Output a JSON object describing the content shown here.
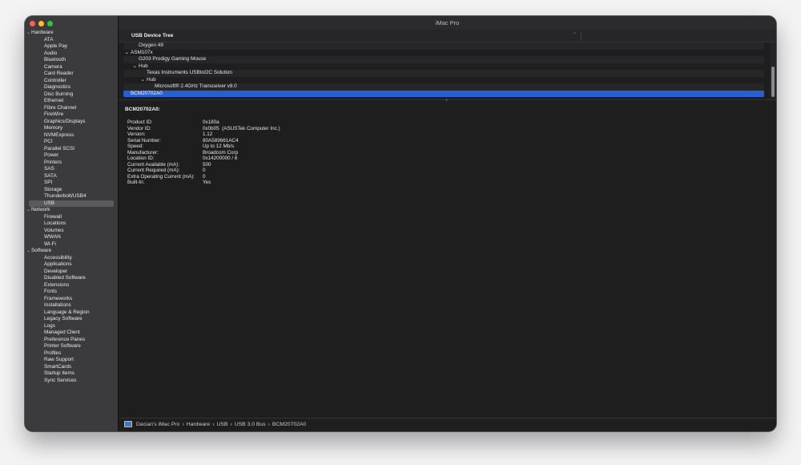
{
  "window": {
    "title": "iMac Pro"
  },
  "colors": {
    "close": "#ff5f57",
    "minimize": "#febc2e",
    "zoom": "#28c840",
    "selection": "#2660d4"
  },
  "sidebar": {
    "items": [
      {
        "label": "Hardware",
        "type": "cat"
      },
      {
        "label": "ATA",
        "type": "item"
      },
      {
        "label": "Apple Pay",
        "type": "item"
      },
      {
        "label": "Audio",
        "type": "item"
      },
      {
        "label": "Bluetooth",
        "type": "item"
      },
      {
        "label": "Camera",
        "type": "item"
      },
      {
        "label": "Card Reader",
        "type": "item"
      },
      {
        "label": "Controller",
        "type": "item"
      },
      {
        "label": "Diagnostics",
        "type": "item"
      },
      {
        "label": "Disc Burning",
        "type": "item"
      },
      {
        "label": "Ethernet",
        "type": "item"
      },
      {
        "label": "Fibre Channel",
        "type": "item"
      },
      {
        "label": "FireWire",
        "type": "item"
      },
      {
        "label": "Graphics/Displays",
        "type": "item"
      },
      {
        "label": "Memory",
        "type": "item"
      },
      {
        "label": "NVMExpress",
        "type": "item"
      },
      {
        "label": "PCI",
        "type": "item"
      },
      {
        "label": "Parallel SCSI",
        "type": "item"
      },
      {
        "label": "Power",
        "type": "item"
      },
      {
        "label": "Printers",
        "type": "item"
      },
      {
        "label": "SAS",
        "type": "item"
      },
      {
        "label": "SATA",
        "type": "item"
      },
      {
        "label": "SPI",
        "type": "item"
      },
      {
        "label": "Storage",
        "type": "item"
      },
      {
        "label": "Thunderbolt/USB4",
        "type": "item"
      },
      {
        "label": "USB",
        "type": "item",
        "selected": true
      },
      {
        "label": "Network",
        "type": "cat"
      },
      {
        "label": "Firewall",
        "type": "item"
      },
      {
        "label": "Locations",
        "type": "item"
      },
      {
        "label": "Volumes",
        "type": "item"
      },
      {
        "label": "WWAN",
        "type": "item"
      },
      {
        "label": "Wi-Fi",
        "type": "item"
      },
      {
        "label": "Software",
        "type": "cat"
      },
      {
        "label": "Accessibility",
        "type": "item"
      },
      {
        "label": "Applications",
        "type": "item"
      },
      {
        "label": "Developer",
        "type": "item"
      },
      {
        "label": "Disabled Software",
        "type": "item"
      },
      {
        "label": "Extensions",
        "type": "item"
      },
      {
        "label": "Fonts",
        "type": "item"
      },
      {
        "label": "Frameworks",
        "type": "item"
      },
      {
        "label": "Installations",
        "type": "item"
      },
      {
        "label": "Language & Region",
        "type": "item"
      },
      {
        "label": "Legacy Software",
        "type": "item"
      },
      {
        "label": "Logs",
        "type": "item"
      },
      {
        "label": "Managed Client",
        "type": "item"
      },
      {
        "label": "Preference Panes",
        "type": "item"
      },
      {
        "label": "Printer Software",
        "type": "item"
      },
      {
        "label": "Profiles",
        "type": "item"
      },
      {
        "label": "Raw Support",
        "type": "item"
      },
      {
        "label": "SmartCards",
        "type": "item"
      },
      {
        "label": "Startup Items",
        "type": "item"
      },
      {
        "label": "Sync Services",
        "type": "item"
      }
    ]
  },
  "usb_tree": {
    "header": "USB Device Tree",
    "rows": [
      {
        "label": "Oxygen 49",
        "level": 2,
        "expanded": null
      },
      {
        "label": "ASM107x",
        "level": 1,
        "expanded": true
      },
      {
        "label": "G203 Prodigy Gaming Mouse",
        "level": 2,
        "expanded": null
      },
      {
        "label": "Hub",
        "level": 2,
        "expanded": true
      },
      {
        "label": "Texas Instruments USBtoI2C Solution",
        "level": 3,
        "expanded": null
      },
      {
        "label": "Hub",
        "level": 3,
        "expanded": true
      },
      {
        "label": "Microsoft® 2.4GHz Transceiver v8.0",
        "level": 4,
        "expanded": null
      },
      {
        "label": "BCM20702A0",
        "level": 1,
        "expanded": null,
        "selected": true
      }
    ]
  },
  "detail": {
    "title": "BCM20702A0:",
    "properties": [
      {
        "key": "Product ID:",
        "value": "0x180a"
      },
      {
        "key": "Vendor ID:",
        "value": "0x0b05  (ASUSTek Computer Inc.)"
      },
      {
        "key": "Version:",
        "value": "1.12"
      },
      {
        "key": "Serial Number:",
        "value": "80A589661AC4"
      },
      {
        "key": "Speed:",
        "value": "Up to 12 Mb/s"
      },
      {
        "key": "Manufacturer:",
        "value": "Broadcom Corp"
      },
      {
        "key": "Location ID:",
        "value": "0x14200000 / 6"
      },
      {
        "key": "Current Available (mA):",
        "value": "500"
      },
      {
        "key": "Current Required (mA):",
        "value": "0"
      },
      {
        "key": "Extra Operating Current (mA):",
        "value": "0"
      },
      {
        "key": "Built-In:",
        "value": "Yes"
      }
    ]
  },
  "pathbar": {
    "segments": [
      "Dacian's iMac Pro",
      "Hardware",
      "USB",
      "USB 3.0 Bus",
      "BCM20702A0"
    ],
    "separator": "›"
  }
}
